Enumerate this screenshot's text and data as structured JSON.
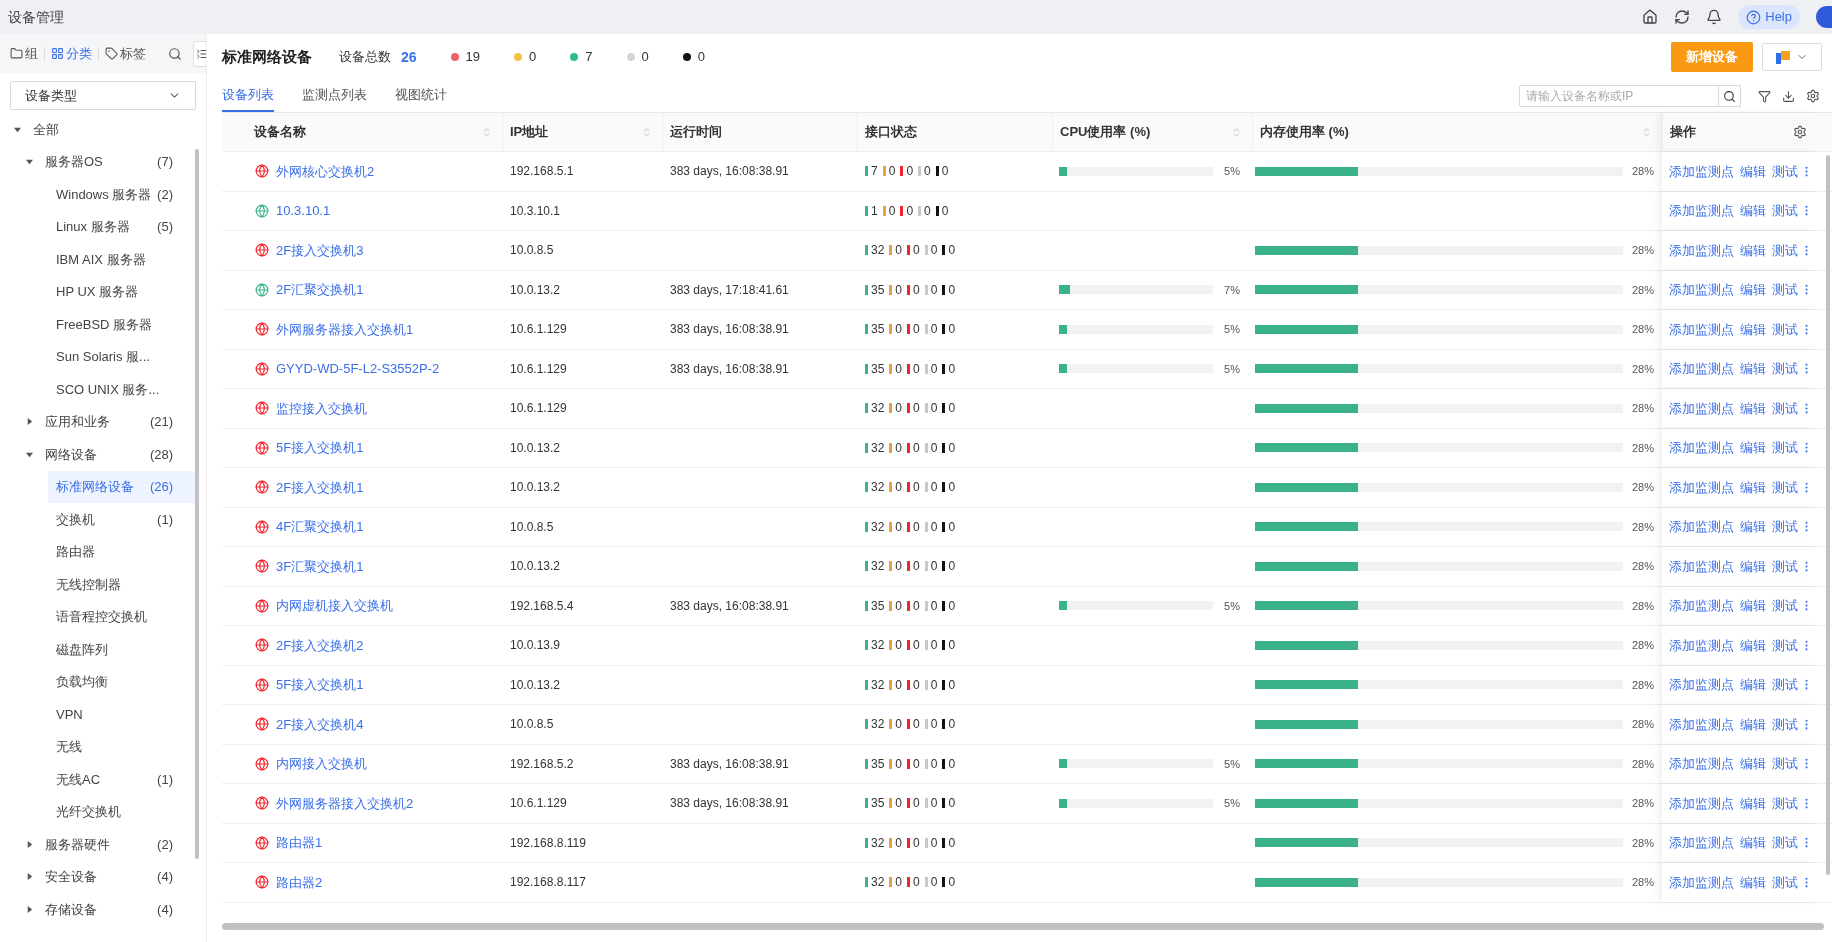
{
  "app_title": "设备管理",
  "top_bar": {
    "help": "Help"
  },
  "sidebar": {
    "tabs": [
      {
        "label": "组",
        "kind": "folder",
        "selected": false
      },
      {
        "label": "分类",
        "kind": "grid",
        "selected": true
      },
      {
        "label": "标签",
        "kind": "tag",
        "selected": false
      }
    ],
    "type_select": "设备类型",
    "tree": [
      {
        "label": "全部",
        "expanded": true,
        "selected": false,
        "children": [
          {
            "label": "服务器OS",
            "count": "(7)",
            "expanded": true,
            "selected": false,
            "children": [
              {
                "label": "Windows 服务器",
                "count": "(2)",
                "selected": false
              },
              {
                "label": "Linux 服务器",
                "count": "(5)",
                "selected": false
              },
              {
                "label": "IBM AIX 服务器",
                "selected": false
              },
              {
                "label": "HP UX 服务器",
                "selected": false
              },
              {
                "label": "FreeBSD 服务器",
                "selected": false
              },
              {
                "label": "Sun Solaris 服...",
                "selected": false
              },
              {
                "label": "SCO UNIX 服务...",
                "selected": false
              }
            ]
          },
          {
            "label": "应用和业务",
            "count": "(21)",
            "expanded": false,
            "selected": false
          },
          {
            "label": "网络设备",
            "count": "(28)",
            "expanded": true,
            "selected": false,
            "children": [
              {
                "label": "标准网络设备",
                "count": "(26)",
                "selected": true
              },
              {
                "label": "交换机",
                "count": "(1)",
                "selected": false
              },
              {
                "label": "路由器",
                "selected": false
              },
              {
                "label": "无线控制器",
                "selected": false
              },
              {
                "label": "语音程控交换机",
                "selected": false
              },
              {
                "label": "磁盘阵列",
                "selected": false
              },
              {
                "label": "负载均衡",
                "selected": false
              },
              {
                "label": "VPN",
                "selected": false
              },
              {
                "label": "无线",
                "selected": false
              },
              {
                "label": "无线AC",
                "count": "(1)",
                "selected": false
              },
              {
                "label": "光纤交换机",
                "selected": false
              }
            ]
          },
          {
            "label": "服务器硬件",
            "count": "(2)",
            "expanded": false,
            "selected": false
          },
          {
            "label": "安全设备",
            "count": "(4)",
            "expanded": false,
            "selected": false
          },
          {
            "label": "存储设备",
            "count": "(4)",
            "expanded": false,
            "selected": false
          }
        ]
      }
    ]
  },
  "header": {
    "title": "标准网络设备",
    "total_label": "设备总数",
    "total": "26",
    "status_counts": [
      {
        "color": "#f0616a",
        "count": "19"
      },
      {
        "color": "#f7c04a",
        "count": "0"
      },
      {
        "color": "#2bc08a",
        "count": "7"
      },
      {
        "color": "#d4d4d4",
        "count": "0"
      },
      {
        "color": "#141414",
        "count": "0"
      }
    ],
    "add_button": "新增设备"
  },
  "tabs": [
    {
      "label": "设备列表",
      "selected": true
    },
    {
      "label": "监测点列表",
      "selected": false
    },
    {
      "label": "视图统计",
      "selected": false
    }
  ],
  "search": {
    "placeholder": "请输入设备名称或IP"
  },
  "table": {
    "columns": [
      {
        "label": "设备名称",
        "sortable": true
      },
      {
        "label": "IP地址",
        "sortable": true
      },
      {
        "label": "运行时间",
        "sortable": false
      },
      {
        "label": "接口状态",
        "sortable": false
      },
      {
        "label": "CPU使用率 (%)",
        "sortable": true
      },
      {
        "label": "内存使用率 (%)",
        "sortable": true
      },
      {
        "label": "操作",
        "sortable": false
      }
    ],
    "rows": [
      {
        "name": "外网核心交换机2",
        "color": "#f5222d",
        "ip": "192.168.5.1",
        "uptime": "383 days, 16:08:38.91",
        "ports": [
          {
            "count": "7",
            "color": "#3bb38a"
          },
          {
            "count": "0",
            "color": "#e6a23c"
          },
          {
            "count": "0",
            "color": "#f5222d"
          },
          {
            "count": "0",
            "color": "#c8c8c8"
          },
          {
            "count": "0",
            "color": "#111111"
          }
        ],
        "cpu": {
          "level": 0.05,
          "text": "5%"
        },
        "mem": {
          "level": 0.28,
          "text": "28%"
        },
        "actions": [
          "添加监测点",
          "编辑",
          "测试"
        ]
      },
      {
        "name": "10.3.10.1",
        "color": "#3bb38a",
        "ip": "10.3.10.1",
        "ports": [
          {
            "count": "1",
            "color": "#3bb38a"
          },
          {
            "count": "0",
            "color": "#e6a23c"
          },
          {
            "count": "0",
            "color": "#f5222d"
          },
          {
            "count": "0",
            "color": "#c8c8c8"
          },
          {
            "count": "0",
            "color": "#111111"
          }
        ],
        "actions": [
          "添加监测点",
          "编辑",
          "测试"
        ]
      },
      {
        "name": "2F接入交换机3",
        "color": "#f5222d",
        "ip": "10.0.8.5",
        "ports": [
          {
            "count": "32",
            "color": "#3bb38a"
          },
          {
            "count": "0",
            "color": "#e6a23c"
          },
          {
            "count": "0",
            "color": "#f5222d"
          },
          {
            "count": "0",
            "color": "#c8c8c8"
          },
          {
            "count": "0",
            "color": "#111111"
          }
        ],
        "mem": {
          "level": 0.28,
          "text": "28%"
        },
        "actions": [
          "添加监测点",
          "编辑",
          "测试"
        ]
      },
      {
        "name": "2F汇聚交换机1",
        "color": "#3bb38a",
        "ip": "10.0.13.2",
        "uptime": "383 days, 17:18:41.61",
        "ports": [
          {
            "count": "35",
            "color": "#3bb38a"
          },
          {
            "count": "0",
            "color": "#e6a23c"
          },
          {
            "count": "0",
            "color": "#f5222d"
          },
          {
            "count": "0",
            "color": "#c8c8c8"
          },
          {
            "count": "0",
            "color": "#111111"
          }
        ],
        "cpu": {
          "level": 0.07,
          "text": "7%"
        },
        "mem": {
          "level": 0.28,
          "text": "28%"
        },
        "actions": [
          "添加监测点",
          "编辑",
          "测试"
        ]
      },
      {
        "name": "外网服务器接入交换机1",
        "color": "#f5222d",
        "ip": "10.6.1.129",
        "uptime": "383 days, 16:08:38.91",
        "ports": [
          {
            "count": "35",
            "color": "#3bb38a"
          },
          {
            "count": "0",
            "color": "#e6a23c"
          },
          {
            "count": "0",
            "color": "#f5222d"
          },
          {
            "count": "0",
            "color": "#c8c8c8"
          },
          {
            "count": "0",
            "color": "#111111"
          }
        ],
        "cpu": {
          "level": 0.05,
          "text": "5%"
        },
        "mem": {
          "level": 0.28,
          "text": "28%"
        },
        "actions": [
          "添加监测点",
          "编辑",
          "测试"
        ]
      },
      {
        "name": "GYYD-WD-5F-L2-S3552P-2",
        "color": "#f5222d",
        "ip": "10.6.1.129",
        "uptime": "383 days, 16:08:38.91",
        "ports": [
          {
            "count": "35",
            "color": "#3bb38a"
          },
          {
            "count": "0",
            "color": "#e6a23c"
          },
          {
            "count": "0",
            "color": "#f5222d"
          },
          {
            "count": "0",
            "color": "#c8c8c8"
          },
          {
            "count": "0",
            "color": "#111111"
          }
        ],
        "cpu": {
          "level": 0.05,
          "text": "5%"
        },
        "mem": {
          "level": 0.28,
          "text": "28%"
        },
        "actions": [
          "添加监测点",
          "编辑",
          "测试"
        ]
      },
      {
        "name": "监控接入交换机",
        "color": "#f5222d",
        "ip": "10.6.1.129",
        "ports": [
          {
            "count": "32",
            "color": "#3bb38a"
          },
          {
            "count": "0",
            "color": "#e6a23c"
          },
          {
            "count": "0",
            "color": "#f5222d"
          },
          {
            "count": "0",
            "color": "#c8c8c8"
          },
          {
            "count": "0",
            "color": "#111111"
          }
        ],
        "mem": {
          "level": 0.28,
          "text": "28%"
        },
        "actions": [
          "添加监测点",
          "编辑",
          "测试"
        ]
      },
      {
        "name": "5F接入交换机1",
        "color": "#f5222d",
        "ip": "10.0.13.2",
        "ports": [
          {
            "count": "32",
            "color": "#3bb38a"
          },
          {
            "count": "0",
            "color": "#e6a23c"
          },
          {
            "count": "0",
            "color": "#f5222d"
          },
          {
            "count": "0",
            "color": "#c8c8c8"
          },
          {
            "count": "0",
            "color": "#111111"
          }
        ],
        "mem": {
          "level": 0.28,
          "text": "28%"
        },
        "actions": [
          "添加监测点",
          "编辑",
          "测试"
        ]
      },
      {
        "name": "2F接入交换机1",
        "color": "#f5222d",
        "ip": "10.0.13.2",
        "ports": [
          {
            "count": "32",
            "color": "#3bb38a"
          },
          {
            "count": "0",
            "color": "#e6a23c"
          },
          {
            "count": "0",
            "color": "#f5222d"
          },
          {
            "count": "0",
            "color": "#c8c8c8"
          },
          {
            "count": "0",
            "color": "#111111"
          }
        ],
        "mem": {
          "level": 0.28,
          "text": "28%"
        },
        "actions": [
          "添加监测点",
          "编辑",
          "测试"
        ]
      },
      {
        "name": "4F汇聚交换机1",
        "color": "#f5222d",
        "ip": "10.0.8.5",
        "ports": [
          {
            "count": "32",
            "color": "#3bb38a"
          },
          {
            "count": "0",
            "color": "#e6a23c"
          },
          {
            "count": "0",
            "color": "#f5222d"
          },
          {
            "count": "0",
            "color": "#c8c8c8"
          },
          {
            "count": "0",
            "color": "#111111"
          }
        ],
        "mem": {
          "level": 0.28,
          "text": "28%"
        },
        "actions": [
          "添加监测点",
          "编辑",
          "测试"
        ]
      },
      {
        "name": "3F汇聚交换机1",
        "color": "#f5222d",
        "ip": "10.0.13.2",
        "ports": [
          {
            "count": "32",
            "color": "#3bb38a"
          },
          {
            "count": "0",
            "color": "#e6a23c"
          },
          {
            "count": "0",
            "color": "#f5222d"
          },
          {
            "count": "0",
            "color": "#c8c8c8"
          },
          {
            "count": "0",
            "color": "#111111"
          }
        ],
        "mem": {
          "level": 0.28,
          "text": "28%"
        },
        "actions": [
          "添加监测点",
          "编辑",
          "测试"
        ]
      },
      {
        "name": "内网虚机接入交换机",
        "color": "#f5222d",
        "ip": "192.168.5.4",
        "uptime": "383 days, 16:08:38.91",
        "ports": [
          {
            "count": "35",
            "color": "#3bb38a"
          },
          {
            "count": "0",
            "color": "#e6a23c"
          },
          {
            "count": "0",
            "color": "#f5222d"
          },
          {
            "count": "0",
            "color": "#c8c8c8"
          },
          {
            "count": "0",
            "color": "#111111"
          }
        ],
        "cpu": {
          "level": 0.05,
          "text": "5%"
        },
        "mem": {
          "level": 0.28,
          "text": "28%"
        },
        "actions": [
          "添加监测点",
          "编辑",
          "测试"
        ]
      },
      {
        "name": "2F接入交换机2",
        "color": "#f5222d",
        "ip": "10.0.13.9",
        "ports": [
          {
            "count": "32",
            "color": "#3bb38a"
          },
          {
            "count": "0",
            "color": "#e6a23c"
          },
          {
            "count": "0",
            "color": "#f5222d"
          },
          {
            "count": "0",
            "color": "#c8c8c8"
          },
          {
            "count": "0",
            "color": "#111111"
          }
        ],
        "mem": {
          "level": 0.28,
          "text": "28%"
        },
        "actions": [
          "添加监测点",
          "编辑",
          "测试"
        ]
      },
      {
        "name": "5F接入交换机1",
        "color": "#f5222d",
        "ip": "10.0.13.2",
        "ports": [
          {
            "count": "32",
            "color": "#3bb38a"
          },
          {
            "count": "0",
            "color": "#e6a23c"
          },
          {
            "count": "0",
            "color": "#f5222d"
          },
          {
            "count": "0",
            "color": "#c8c8c8"
          },
          {
            "count": "0",
            "color": "#111111"
          }
        ],
        "mem": {
          "level": 0.28,
          "text": "28%"
        },
        "actions": [
          "添加监测点",
          "编辑",
          "测试"
        ]
      },
      {
        "name": "2F接入交换机4",
        "color": "#f5222d",
        "ip": "10.0.8.5",
        "ports": [
          {
            "count": "32",
            "color": "#3bb38a"
          },
          {
            "count": "0",
            "color": "#e6a23c"
          },
          {
            "count": "0",
            "color": "#f5222d"
          },
          {
            "count": "0",
            "color": "#c8c8c8"
          },
          {
            "count": "0",
            "color": "#111111"
          }
        ],
        "mem": {
          "level": 0.28,
          "text": "28%"
        },
        "actions": [
          "添加监测点",
          "编辑",
          "测试"
        ]
      },
      {
        "name": "内网接入交换机",
        "color": "#f5222d",
        "ip": "192.168.5.2",
        "uptime": "383 days, 16:08:38.91",
        "ports": [
          {
            "count": "35",
            "color": "#3bb38a"
          },
          {
            "count": "0",
            "color": "#e6a23c"
          },
          {
            "count": "0",
            "color": "#f5222d"
          },
          {
            "count": "0",
            "color": "#c8c8c8"
          },
          {
            "count": "0",
            "color": "#111111"
          }
        ],
        "cpu": {
          "level": 0.05,
          "text": "5%"
        },
        "mem": {
          "level": 0.28,
          "text": "28%"
        },
        "actions": [
          "添加监测点",
          "编辑",
          "测试"
        ]
      },
      {
        "name": "外网服务器接入交换机2",
        "color": "#f5222d",
        "ip": "10.6.1.129",
        "uptime": "383 days, 16:08:38.91",
        "ports": [
          {
            "count": "35",
            "color": "#3bb38a"
          },
          {
            "count": "0",
            "color": "#e6a23c"
          },
          {
            "count": "0",
            "color": "#f5222d"
          },
          {
            "count": "0",
            "color": "#c8c8c8"
          },
          {
            "count": "0",
            "color": "#111111"
          }
        ],
        "cpu": {
          "level": 0.05,
          "text": "5%"
        },
        "mem": {
          "level": 0.28,
          "text": "28%"
        },
        "actions": [
          "添加监测点",
          "编辑",
          "测试"
        ]
      },
      {
        "name": "路由器1",
        "color": "#f5222d",
        "ip": "192.168.8.119",
        "ports": [
          {
            "count": "32",
            "color": "#3bb38a"
          },
          {
            "count": "0",
            "color": "#e6a23c"
          },
          {
            "count": "0",
            "color": "#f5222d"
          },
          {
            "count": "0",
            "color": "#c8c8c8"
          },
          {
            "count": "0",
            "color": "#111111"
          }
        ],
        "mem": {
          "level": 0.28,
          "text": "28%"
        },
        "actions": [
          "添加监测点",
          "编辑",
          "测试"
        ]
      },
      {
        "name": "路由器2",
        "color": "#f5222d",
        "ip": "192.168.8.117",
        "ports": [
          {
            "count": "32",
            "color": "#3bb38a"
          },
          {
            "count": "0",
            "color": "#e6a23c"
          },
          {
            "count": "0",
            "color": "#f5222d"
          },
          {
            "count": "0",
            "color": "#c8c8c8"
          },
          {
            "count": "0",
            "color": "#111111"
          }
        ],
        "mem": {
          "level": 0.28,
          "text": "28%"
        },
        "actions": [
          "添加监测点",
          "编辑",
          "测试"
        ]
      }
    ]
  }
}
